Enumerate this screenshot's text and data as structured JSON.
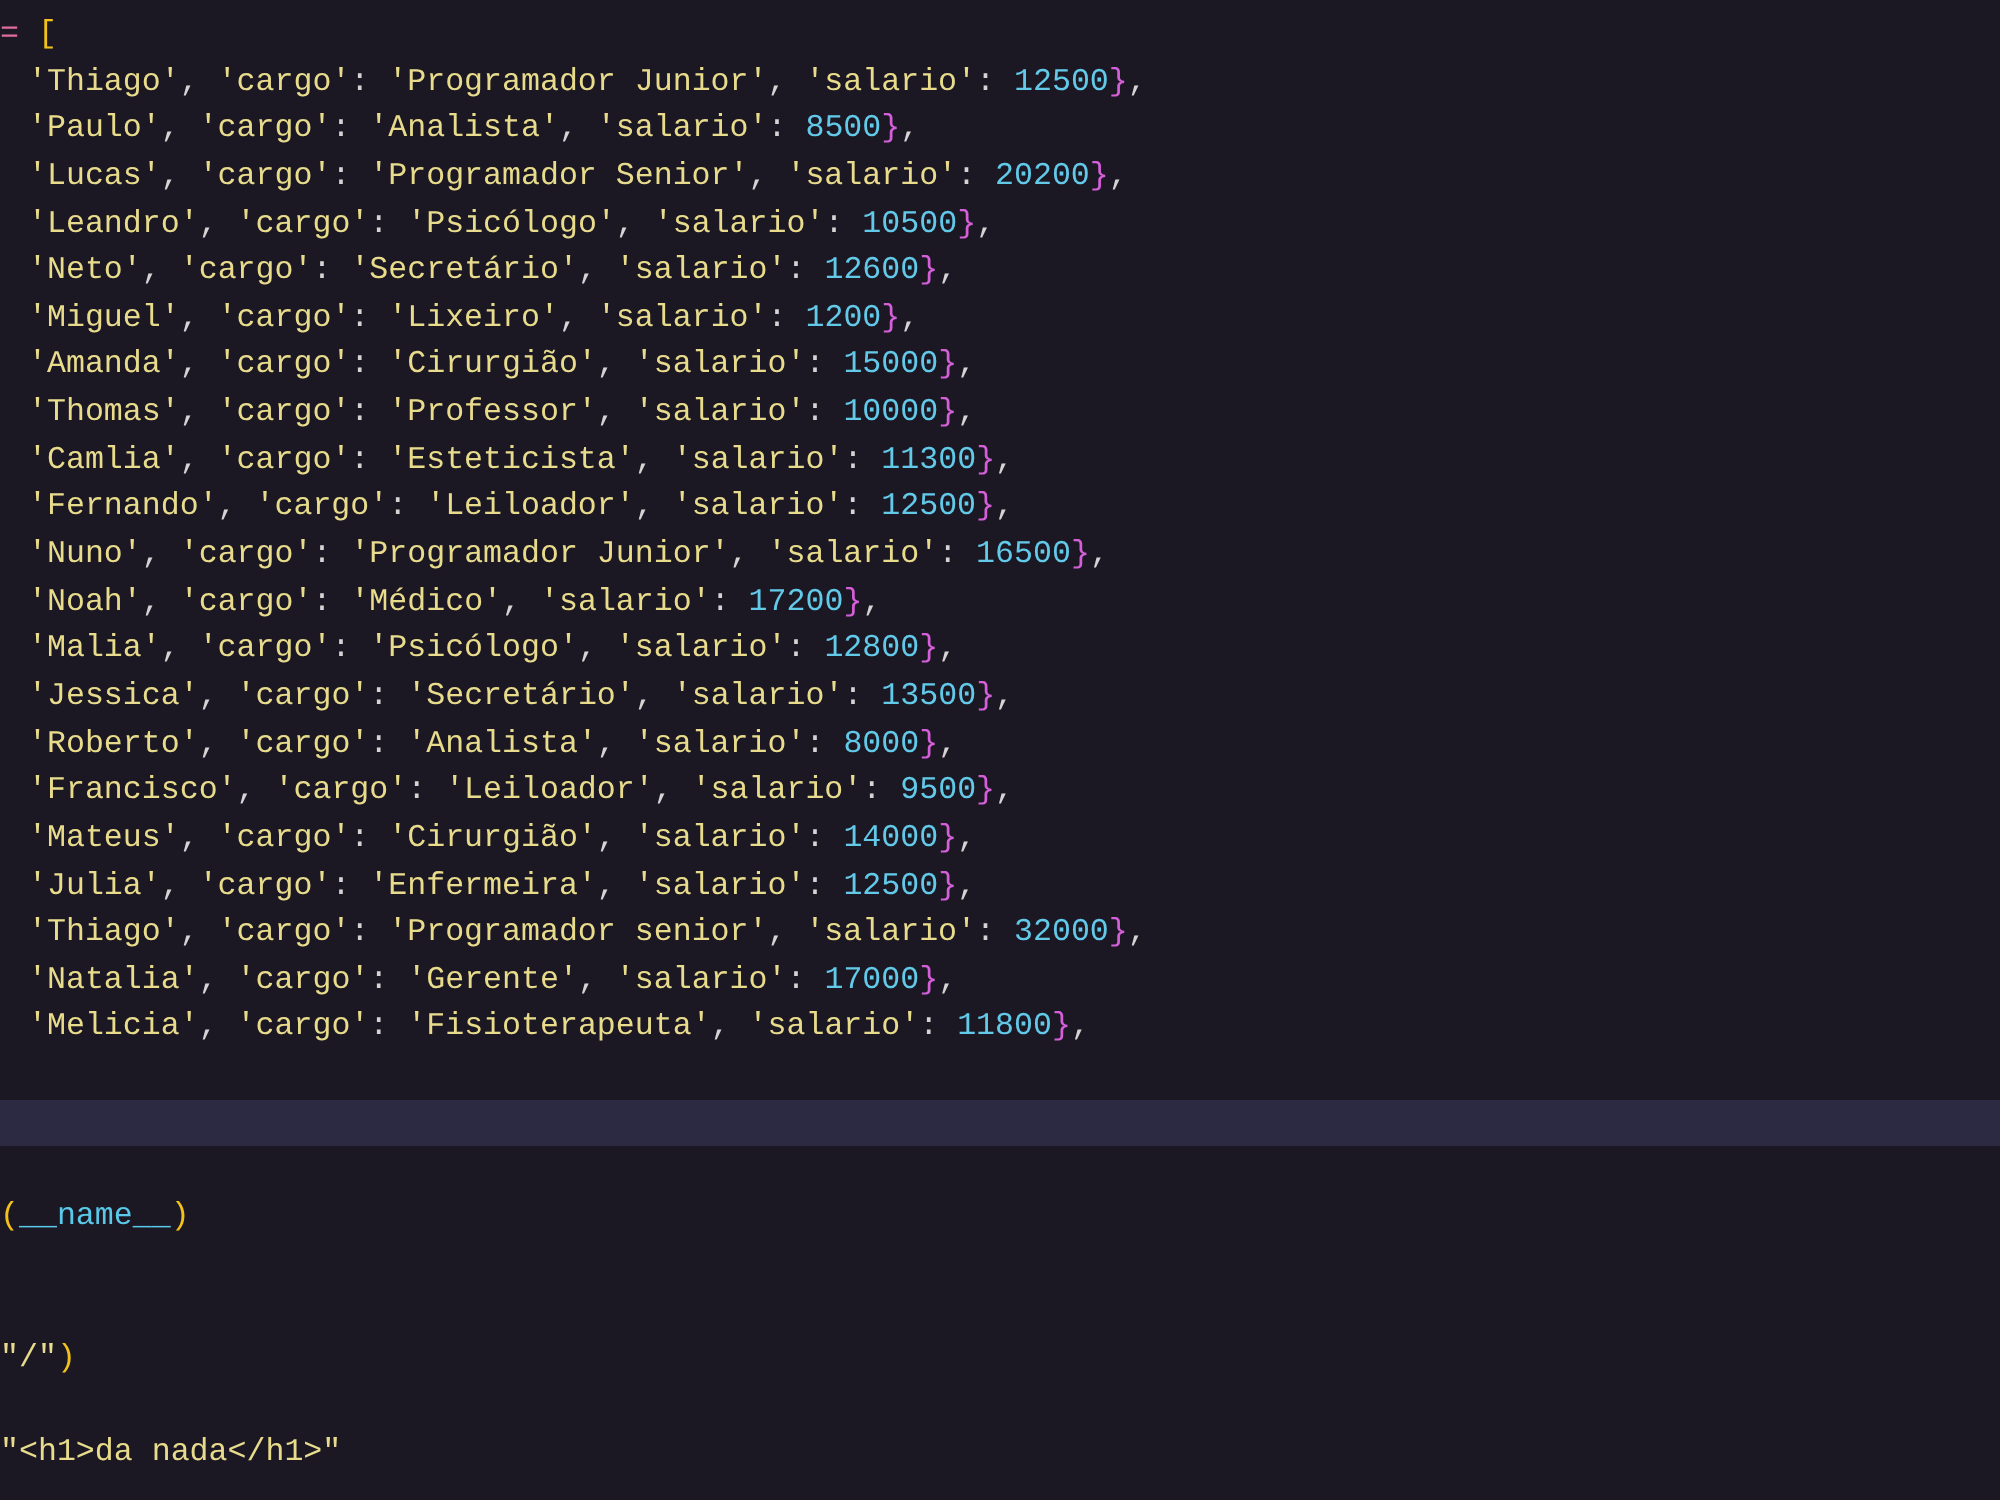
{
  "editor": {
    "lines": [
      {
        "current": false,
        "tokens": [
          {
            "text": "= ",
            "kind": "operator"
          },
          {
            "text": "[",
            "kind": "bracket"
          }
        ]
      },
      {
        "current": false,
        "tokens": [
          {
            "text": "'Thiago'",
            "kind": "string"
          },
          {
            "text": ", ",
            "kind": "punct"
          },
          {
            "text": "'cargo'",
            "kind": "string"
          },
          {
            "text": ": ",
            "kind": "punct"
          },
          {
            "text": "'Programador Junior'",
            "kind": "string"
          },
          {
            "text": ", ",
            "kind": "punct"
          },
          {
            "text": "'salario'",
            "kind": "string"
          },
          {
            "text": ": ",
            "kind": "punct"
          },
          {
            "text": "12500",
            "kind": "number"
          },
          {
            "text": "}",
            "kind": "brace"
          },
          {
            "text": ",",
            "kind": "punct"
          }
        ]
      },
      {
        "current": false,
        "tokens": [
          {
            "text": "'Paulo'",
            "kind": "string"
          },
          {
            "text": ", ",
            "kind": "punct"
          },
          {
            "text": "'cargo'",
            "kind": "string"
          },
          {
            "text": ": ",
            "kind": "punct"
          },
          {
            "text": "'Analista'",
            "kind": "string"
          },
          {
            "text": ", ",
            "kind": "punct"
          },
          {
            "text": "'salario'",
            "kind": "string"
          },
          {
            "text": ": ",
            "kind": "punct"
          },
          {
            "text": "8500",
            "kind": "number"
          },
          {
            "text": "}",
            "kind": "brace"
          },
          {
            "text": ",",
            "kind": "punct"
          }
        ]
      },
      {
        "current": false,
        "tokens": [
          {
            "text": "'Lucas'",
            "kind": "string"
          },
          {
            "text": ", ",
            "kind": "punct"
          },
          {
            "text": "'cargo'",
            "kind": "string"
          },
          {
            "text": ": ",
            "kind": "punct"
          },
          {
            "text": "'Programador Senior'",
            "kind": "string"
          },
          {
            "text": ", ",
            "kind": "punct"
          },
          {
            "text": "'salario'",
            "kind": "string"
          },
          {
            "text": ": ",
            "kind": "punct"
          },
          {
            "text": "20200",
            "kind": "number"
          },
          {
            "text": "}",
            "kind": "brace"
          },
          {
            "text": ",",
            "kind": "punct"
          }
        ]
      },
      {
        "current": false,
        "tokens": [
          {
            "text": "'Leandro'",
            "kind": "string"
          },
          {
            "text": ", ",
            "kind": "punct"
          },
          {
            "text": "'cargo'",
            "kind": "string"
          },
          {
            "text": ": ",
            "kind": "punct"
          },
          {
            "text": "'Psicólogo'",
            "kind": "string"
          },
          {
            "text": ", ",
            "kind": "punct"
          },
          {
            "text": "'salario'",
            "kind": "string"
          },
          {
            "text": ": ",
            "kind": "punct"
          },
          {
            "text": "10500",
            "kind": "number"
          },
          {
            "text": "}",
            "kind": "brace"
          },
          {
            "text": ",",
            "kind": "punct"
          }
        ]
      },
      {
        "current": false,
        "tokens": [
          {
            "text": "'Neto'",
            "kind": "string"
          },
          {
            "text": ", ",
            "kind": "punct"
          },
          {
            "text": "'cargo'",
            "kind": "string"
          },
          {
            "text": ": ",
            "kind": "punct"
          },
          {
            "text": "'Secretário'",
            "kind": "string"
          },
          {
            "text": ", ",
            "kind": "punct"
          },
          {
            "text": "'salario'",
            "kind": "string"
          },
          {
            "text": ": ",
            "kind": "punct"
          },
          {
            "text": "12600",
            "kind": "number"
          },
          {
            "text": "}",
            "kind": "brace"
          },
          {
            "text": ",",
            "kind": "punct"
          }
        ]
      },
      {
        "current": false,
        "tokens": [
          {
            "text": "'Miguel'",
            "kind": "string"
          },
          {
            "text": ", ",
            "kind": "punct"
          },
          {
            "text": "'cargo'",
            "kind": "string"
          },
          {
            "text": ": ",
            "kind": "punct"
          },
          {
            "text": "'Lixeiro'",
            "kind": "string"
          },
          {
            "text": ", ",
            "kind": "punct"
          },
          {
            "text": "'salario'",
            "kind": "string"
          },
          {
            "text": ": ",
            "kind": "punct"
          },
          {
            "text": "1200",
            "kind": "number"
          },
          {
            "text": "}",
            "kind": "brace"
          },
          {
            "text": ",",
            "kind": "punct"
          }
        ]
      },
      {
        "current": false,
        "tokens": [
          {
            "text": "'Amanda'",
            "kind": "string"
          },
          {
            "text": ", ",
            "kind": "punct"
          },
          {
            "text": "'cargo'",
            "kind": "string"
          },
          {
            "text": ": ",
            "kind": "punct"
          },
          {
            "text": "'Cirurgião'",
            "kind": "string"
          },
          {
            "text": ", ",
            "kind": "punct"
          },
          {
            "text": "'salario'",
            "kind": "string"
          },
          {
            "text": ": ",
            "kind": "punct"
          },
          {
            "text": "15000",
            "kind": "number"
          },
          {
            "text": "}",
            "kind": "brace"
          },
          {
            "text": ",",
            "kind": "punct"
          }
        ]
      },
      {
        "current": false,
        "tokens": [
          {
            "text": "'Thomas'",
            "kind": "string"
          },
          {
            "text": ", ",
            "kind": "punct"
          },
          {
            "text": "'cargo'",
            "kind": "string"
          },
          {
            "text": ": ",
            "kind": "punct"
          },
          {
            "text": "'Professor'",
            "kind": "string"
          },
          {
            "text": ", ",
            "kind": "punct"
          },
          {
            "text": "'salario'",
            "kind": "string"
          },
          {
            "text": ": ",
            "kind": "punct"
          },
          {
            "text": "10000",
            "kind": "number"
          },
          {
            "text": "}",
            "kind": "brace"
          },
          {
            "text": ",",
            "kind": "punct"
          }
        ]
      },
      {
        "current": false,
        "tokens": [
          {
            "text": "'Camlia'",
            "kind": "string"
          },
          {
            "text": ", ",
            "kind": "punct"
          },
          {
            "text": "'cargo'",
            "kind": "string"
          },
          {
            "text": ": ",
            "kind": "punct"
          },
          {
            "text": "'Esteticista'",
            "kind": "string"
          },
          {
            "text": ", ",
            "kind": "punct"
          },
          {
            "text": "'salario'",
            "kind": "string"
          },
          {
            "text": ": ",
            "kind": "punct"
          },
          {
            "text": "11300",
            "kind": "number"
          },
          {
            "text": "}",
            "kind": "brace"
          },
          {
            "text": ",",
            "kind": "punct"
          }
        ]
      },
      {
        "current": false,
        "tokens": [
          {
            "text": "'Fernando'",
            "kind": "string"
          },
          {
            "text": ", ",
            "kind": "punct"
          },
          {
            "text": "'cargo'",
            "kind": "string"
          },
          {
            "text": ": ",
            "kind": "punct"
          },
          {
            "text": "'Leiloador'",
            "kind": "string"
          },
          {
            "text": ", ",
            "kind": "punct"
          },
          {
            "text": "'salario'",
            "kind": "string"
          },
          {
            "text": ": ",
            "kind": "punct"
          },
          {
            "text": "12500",
            "kind": "number"
          },
          {
            "text": "}",
            "kind": "brace"
          },
          {
            "text": ",",
            "kind": "punct"
          }
        ]
      },
      {
        "current": false,
        "tokens": [
          {
            "text": "'Nuno'",
            "kind": "string"
          },
          {
            "text": ", ",
            "kind": "punct"
          },
          {
            "text": "'cargo'",
            "kind": "string"
          },
          {
            "text": ": ",
            "kind": "punct"
          },
          {
            "text": "'Programador Junior'",
            "kind": "string"
          },
          {
            "text": ", ",
            "kind": "punct"
          },
          {
            "text": "'salario'",
            "kind": "string"
          },
          {
            "text": ": ",
            "kind": "punct"
          },
          {
            "text": "16500",
            "kind": "number"
          },
          {
            "text": "}",
            "kind": "brace"
          },
          {
            "text": ",",
            "kind": "punct"
          }
        ]
      },
      {
        "current": false,
        "tokens": [
          {
            "text": "'Noah'",
            "kind": "string"
          },
          {
            "text": ", ",
            "kind": "punct"
          },
          {
            "text": "'cargo'",
            "kind": "string"
          },
          {
            "text": ": ",
            "kind": "punct"
          },
          {
            "text": "'Médico'",
            "kind": "string"
          },
          {
            "text": ", ",
            "kind": "punct"
          },
          {
            "text": "'salario'",
            "kind": "string"
          },
          {
            "text": ": ",
            "kind": "punct"
          },
          {
            "text": "17200",
            "kind": "number"
          },
          {
            "text": "}",
            "kind": "brace"
          },
          {
            "text": ",",
            "kind": "punct"
          }
        ]
      },
      {
        "current": false,
        "tokens": [
          {
            "text": "'Malia'",
            "kind": "string"
          },
          {
            "text": ", ",
            "kind": "punct"
          },
          {
            "text": "'cargo'",
            "kind": "string"
          },
          {
            "text": ": ",
            "kind": "punct"
          },
          {
            "text": "'Psicólogo'",
            "kind": "string"
          },
          {
            "text": ", ",
            "kind": "punct"
          },
          {
            "text": "'salario'",
            "kind": "string"
          },
          {
            "text": ": ",
            "kind": "punct"
          },
          {
            "text": "12800",
            "kind": "number"
          },
          {
            "text": "}",
            "kind": "brace"
          },
          {
            "text": ",",
            "kind": "punct"
          }
        ]
      },
      {
        "current": false,
        "tokens": [
          {
            "text": "'Jessica'",
            "kind": "string"
          },
          {
            "text": ", ",
            "kind": "punct"
          },
          {
            "text": "'cargo'",
            "kind": "string"
          },
          {
            "text": ": ",
            "kind": "punct"
          },
          {
            "text": "'Secretário'",
            "kind": "string"
          },
          {
            "text": ", ",
            "kind": "punct"
          },
          {
            "text": "'salario'",
            "kind": "string"
          },
          {
            "text": ": ",
            "kind": "punct"
          },
          {
            "text": "13500",
            "kind": "number"
          },
          {
            "text": "}",
            "kind": "brace"
          },
          {
            "text": ",",
            "kind": "punct"
          }
        ]
      },
      {
        "current": false,
        "tokens": [
          {
            "text": "'Roberto'",
            "kind": "string"
          },
          {
            "text": ", ",
            "kind": "punct"
          },
          {
            "text": "'cargo'",
            "kind": "string"
          },
          {
            "text": ": ",
            "kind": "punct"
          },
          {
            "text": "'Analista'",
            "kind": "string"
          },
          {
            "text": ", ",
            "kind": "punct"
          },
          {
            "text": "'salario'",
            "kind": "string"
          },
          {
            "text": ": ",
            "kind": "punct"
          },
          {
            "text": "8000",
            "kind": "number"
          },
          {
            "text": "}",
            "kind": "brace"
          },
          {
            "text": ",",
            "kind": "punct"
          }
        ]
      },
      {
        "current": false,
        "tokens": [
          {
            "text": "'Francisco'",
            "kind": "string"
          },
          {
            "text": ", ",
            "kind": "punct"
          },
          {
            "text": "'cargo'",
            "kind": "string"
          },
          {
            "text": ": ",
            "kind": "punct"
          },
          {
            "text": "'Leiloador'",
            "kind": "string"
          },
          {
            "text": ", ",
            "kind": "punct"
          },
          {
            "text": "'salario'",
            "kind": "string"
          },
          {
            "text": ": ",
            "kind": "punct"
          },
          {
            "text": "9500",
            "kind": "number"
          },
          {
            "text": "}",
            "kind": "brace"
          },
          {
            "text": ",",
            "kind": "punct"
          }
        ]
      },
      {
        "current": false,
        "tokens": [
          {
            "text": "'Mateus'",
            "kind": "string"
          },
          {
            "text": ", ",
            "kind": "punct"
          },
          {
            "text": "'cargo'",
            "kind": "string"
          },
          {
            "text": ": ",
            "kind": "punct"
          },
          {
            "text": "'Cirurgião'",
            "kind": "string"
          },
          {
            "text": ", ",
            "kind": "punct"
          },
          {
            "text": "'salario'",
            "kind": "string"
          },
          {
            "text": ": ",
            "kind": "punct"
          },
          {
            "text": "14000",
            "kind": "number"
          },
          {
            "text": "}",
            "kind": "brace"
          },
          {
            "text": ",",
            "kind": "punct"
          }
        ]
      },
      {
        "current": false,
        "tokens": [
          {
            "text": "'Julia'",
            "kind": "string"
          },
          {
            "text": ", ",
            "kind": "punct"
          },
          {
            "text": "'cargo'",
            "kind": "string"
          },
          {
            "text": ": ",
            "kind": "punct"
          },
          {
            "text": "'Enfermeira'",
            "kind": "string"
          },
          {
            "text": ", ",
            "kind": "punct"
          },
          {
            "text": "'salario'",
            "kind": "string"
          },
          {
            "text": ": ",
            "kind": "punct"
          },
          {
            "text": "12500",
            "kind": "number"
          },
          {
            "text": "}",
            "kind": "brace"
          },
          {
            "text": ",",
            "kind": "punct"
          }
        ]
      },
      {
        "current": false,
        "tokens": [
          {
            "text": "'Thiago'",
            "kind": "string"
          },
          {
            "text": ", ",
            "kind": "punct"
          },
          {
            "text": "'cargo'",
            "kind": "string"
          },
          {
            "text": ": ",
            "kind": "punct"
          },
          {
            "text": "'Programador senior'",
            "kind": "string"
          },
          {
            "text": ", ",
            "kind": "punct"
          },
          {
            "text": "'salario'",
            "kind": "string"
          },
          {
            "text": ": ",
            "kind": "punct"
          },
          {
            "text": "32000",
            "kind": "number"
          },
          {
            "text": "}",
            "kind": "brace"
          },
          {
            "text": ",",
            "kind": "punct"
          }
        ]
      },
      {
        "current": false,
        "tokens": [
          {
            "text": "'Natalia'",
            "kind": "string"
          },
          {
            "text": ", ",
            "kind": "punct"
          },
          {
            "text": "'cargo'",
            "kind": "string"
          },
          {
            "text": ": ",
            "kind": "punct"
          },
          {
            "text": "'Gerente'",
            "kind": "string"
          },
          {
            "text": ", ",
            "kind": "punct"
          },
          {
            "text": "'salario'",
            "kind": "string"
          },
          {
            "text": ": ",
            "kind": "punct"
          },
          {
            "text": "17000",
            "kind": "number"
          },
          {
            "text": "}",
            "kind": "brace"
          },
          {
            "text": ",",
            "kind": "punct"
          }
        ]
      },
      {
        "current": false,
        "tokens": [
          {
            "text": "'Melicia'",
            "kind": "string"
          },
          {
            "text": ", ",
            "kind": "punct"
          },
          {
            "text": "'cargo'",
            "kind": "string"
          },
          {
            "text": ": ",
            "kind": "punct"
          },
          {
            "text": "'Fisioterapeuta'",
            "kind": "string"
          },
          {
            "text": ", ",
            "kind": "punct"
          },
          {
            "text": "'salario'",
            "kind": "string"
          },
          {
            "text": ": ",
            "kind": "punct"
          },
          {
            "text": "11800",
            "kind": "number"
          },
          {
            "text": "}",
            "kind": "brace"
          },
          {
            "text": ",",
            "kind": "punct"
          }
        ]
      },
      {
        "current": false
      },
      {
        "current": true
      },
      {
        "current": false
      },
      {
        "current": false,
        "tokens": [
          {
            "text": "(",
            "kind": "paren"
          },
          {
            "text": "__name__",
            "kind": "variable"
          },
          {
            "text": ")",
            "kind": "paren"
          }
        ]
      },
      {
        "current": false
      },
      {
        "current": false
      },
      {
        "current": false,
        "tokens": [
          {
            "text": "\"/\"",
            "kind": "string"
          },
          {
            "text": ")",
            "kind": "paren"
          }
        ]
      },
      {
        "current": false
      },
      {
        "current": false,
        "tokens": [
          {
            "text": "\"<h1>da nada</h1>\"",
            "kind": "string"
          }
        ]
      }
    ]
  }
}
